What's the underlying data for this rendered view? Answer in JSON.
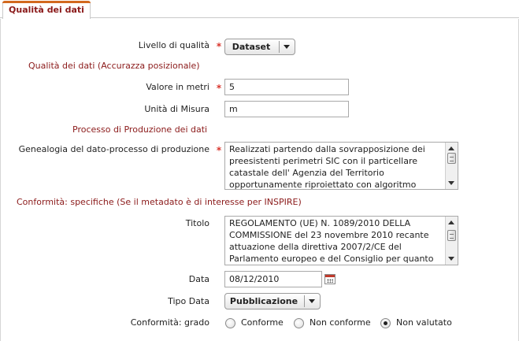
{
  "tab": {
    "label": "Qualità dei dati"
  },
  "form": {
    "livello": {
      "label": "Livello di qualità",
      "value": "Dataset"
    },
    "section_accuratezza": "Qualità dei dati (Accurazza posizionale)",
    "valore": {
      "label": "Valore in metri",
      "value": "5"
    },
    "unita": {
      "label": "Unità di Misura",
      "value": "m"
    },
    "section_processo": "Processo di Produzione dei dati",
    "genealogia": {
      "label": "Genealogia del dato-processo di produzione",
      "lines": [
        "Realizzati partendo dalla sovrapposizione dei",
        "preesistenti perimetri SIC con il particellare",
        "catastale dell' Agenzia del Territorio",
        "opportunamente riproiettato con algoritmo"
      ]
    },
    "section_conformita": "Conformità: specifiche  (Se il metadato è di interesse per INSPIRE)",
    "titolo": {
      "label": "Titolo",
      "lines": [
        "REGOLAMENTO (UE) N. 1089/2010 DELLA",
        "COMMISSIONE del 23 novembre 2010 recante",
        "attuazione della direttiva 2007/2/CE del",
        "Parlamento europeo e del Consiglio per quanto"
      ]
    },
    "data": {
      "label": "Data",
      "value": "08/12/2010"
    },
    "tipo_data": {
      "label": "Tipo Data",
      "value": "Pubblicazione"
    },
    "grado": {
      "label": "Conformità: grado",
      "options": [
        "Conforme",
        "Non conforme",
        "Non valutato"
      ],
      "selected": "Non valutato"
    }
  },
  "required_mark": "*"
}
